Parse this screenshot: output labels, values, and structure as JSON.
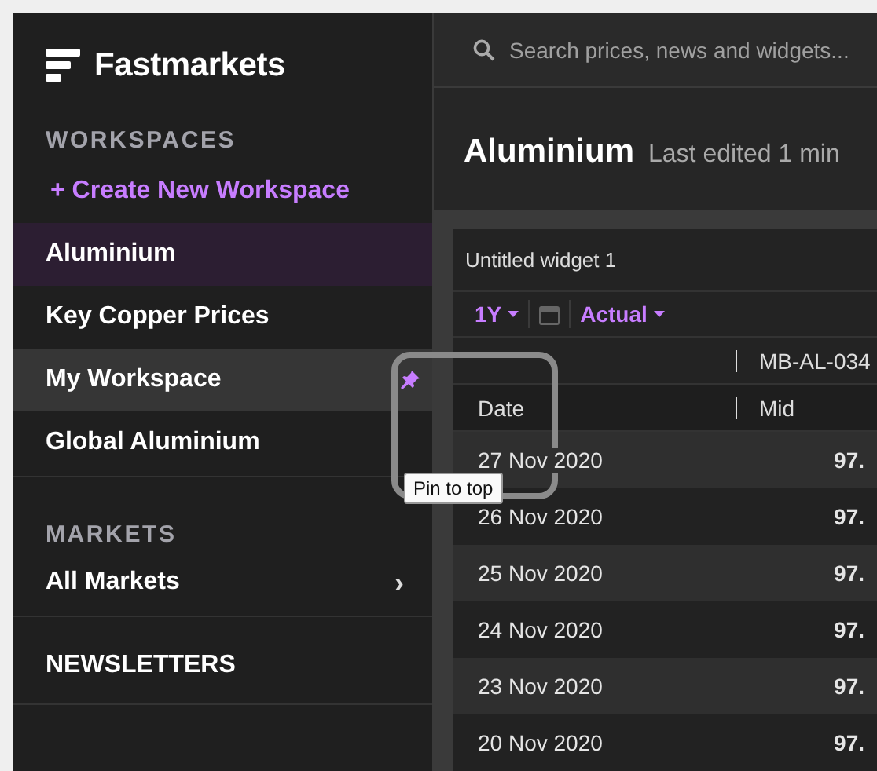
{
  "sidebar": {
    "brand": "Fastmarkets",
    "workspaces_heading": "WORKSPACES",
    "create_link": "+ Create New Workspace",
    "workspaces": [
      {
        "label": "Aluminium",
        "selected": true,
        "hovered": false,
        "pinned": false
      },
      {
        "label": "Key Copper Prices",
        "selected": false,
        "hovered": false,
        "pinned": false
      },
      {
        "label": "My Workspace",
        "selected": false,
        "hovered": true,
        "pinned": true
      },
      {
        "label": "Global Aluminium",
        "selected": false,
        "hovered": false,
        "pinned": false
      }
    ],
    "markets_heading": "MARKETS",
    "markets_item": {
      "label": "All Markets",
      "chevron": "›"
    },
    "newsletters_heading": "NEWSLETTERS"
  },
  "tooltip": {
    "text": "Pin to top"
  },
  "search": {
    "placeholder": "Search prices, news and widgets..."
  },
  "page": {
    "title": "Aluminium",
    "subtitle": "Last edited 1 min"
  },
  "widget": {
    "title": "Untitled widget 1",
    "range": "1Y",
    "mode": "Actual",
    "symbol": "MB-AL-034",
    "columns": [
      "Date",
      "Mid"
    ],
    "rows": [
      {
        "date": "27 Nov 2020",
        "mid": "97."
      },
      {
        "date": "26 Nov 2020",
        "mid": "97."
      },
      {
        "date": "25 Nov 2020",
        "mid": "97."
      },
      {
        "date": "24 Nov 2020",
        "mid": "97."
      },
      {
        "date": "23 Nov 2020",
        "mid": "97."
      },
      {
        "date": "20 Nov 2020",
        "mid": "97."
      }
    ]
  }
}
